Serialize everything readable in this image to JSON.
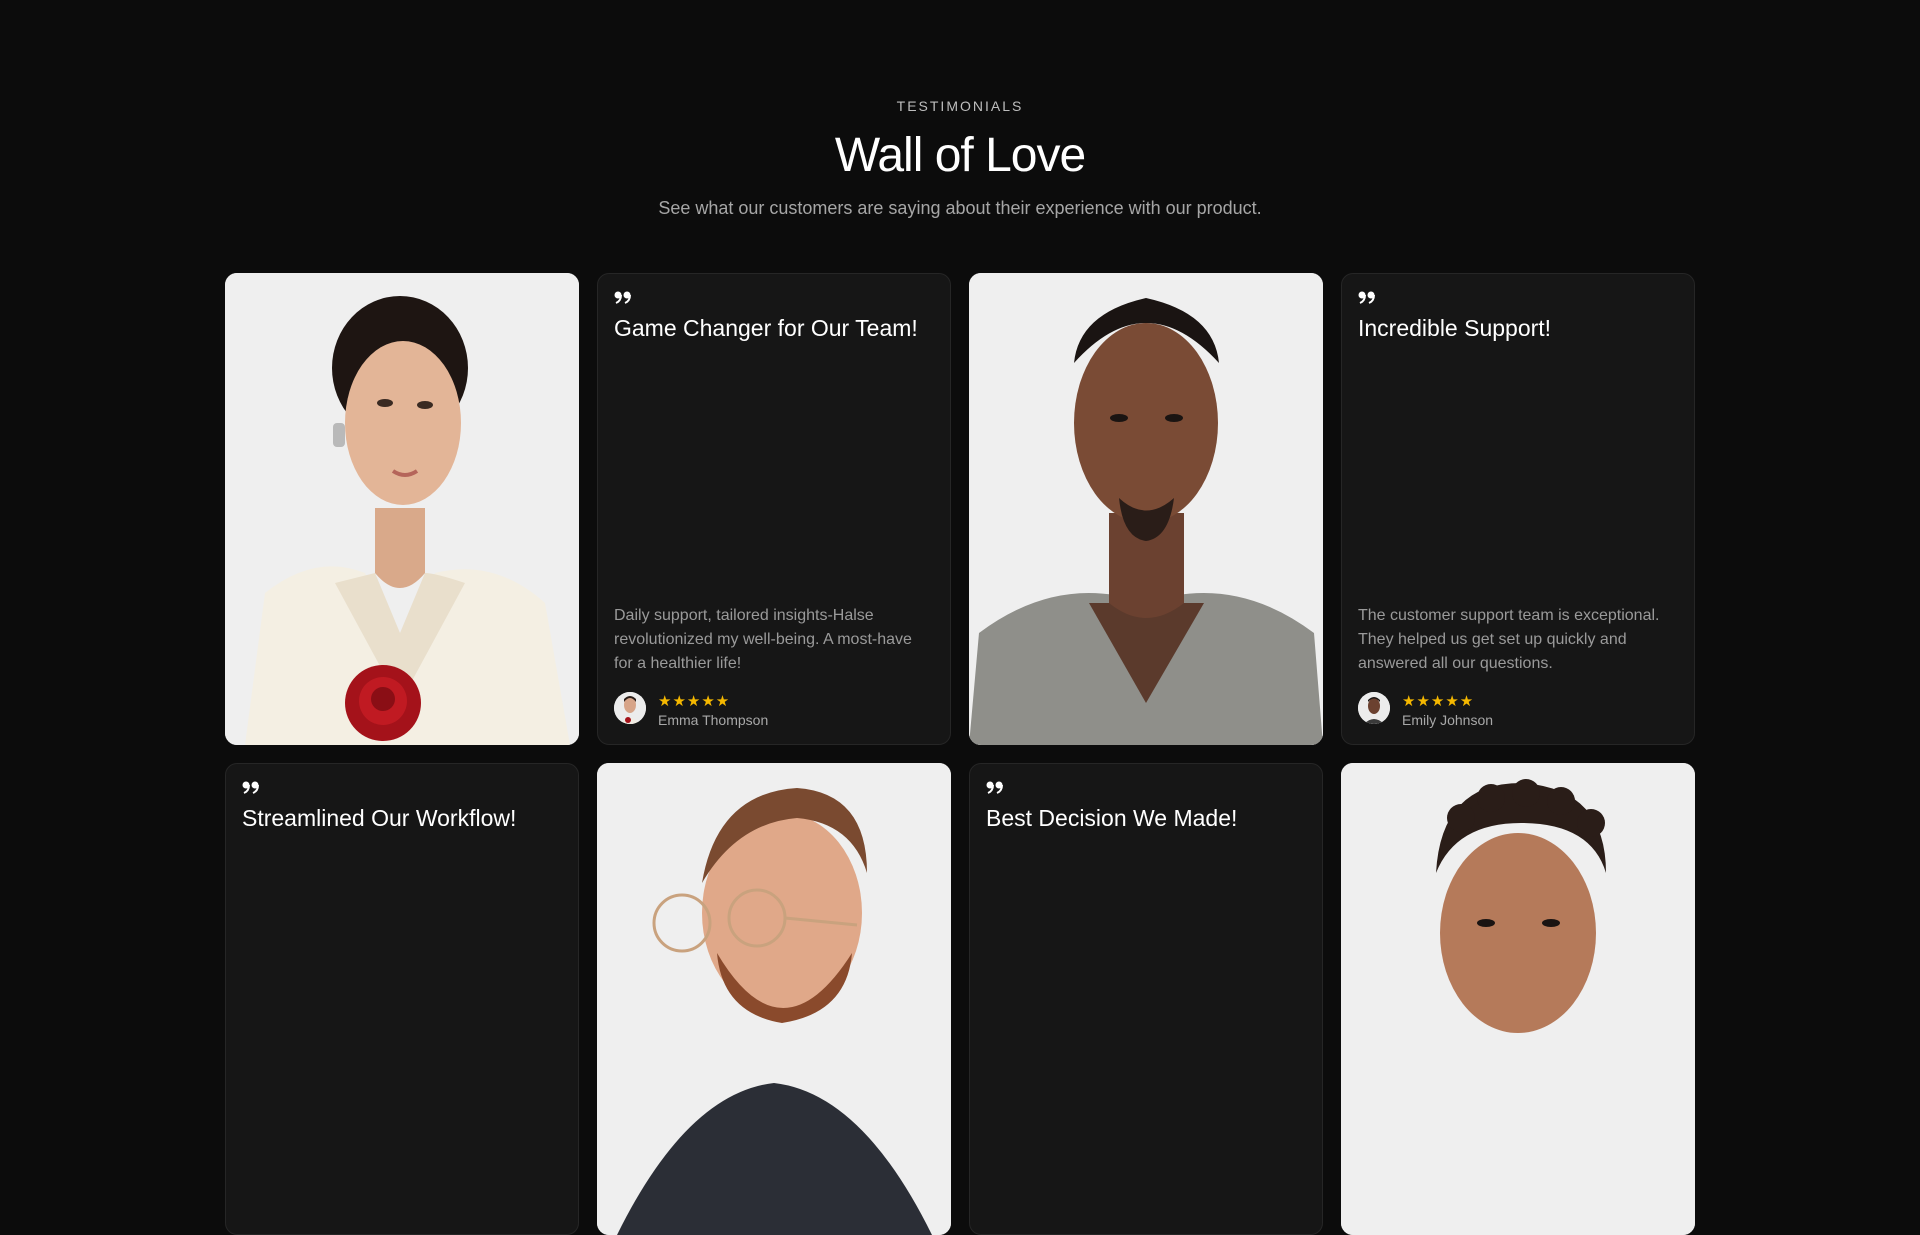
{
  "section": {
    "eyebrow": "TESTIMONIALS",
    "title": "Wall of Love",
    "subtitle": "See what our customers are saying about their experience with our product."
  },
  "colors": {
    "background": "#0c0c0c",
    "card": "#161616",
    "photo_bg": "#efefef",
    "star": "#f5b800"
  },
  "testimonials": [
    {
      "title": "Game Changer for Our Team!",
      "body": "Daily support, tailored insights-Halse revolutionized my well-being. A most-have for a healthier life!",
      "rating": 5,
      "stars": "★★★★★",
      "author": "Emma Thompson"
    },
    {
      "title": "Incredible Support!",
      "body": "The customer support team is exceptional. They helped us get set up quickly and answered all our questions.",
      "rating": 5,
      "stars": "★★★★★",
      "author": "Emily Johnson"
    },
    {
      "title": "Streamlined Our Workflow!"
    },
    {
      "title": "Best Decision We Made!"
    }
  ],
  "icons": {
    "quote": "quote-icon",
    "avatar": "avatar"
  }
}
